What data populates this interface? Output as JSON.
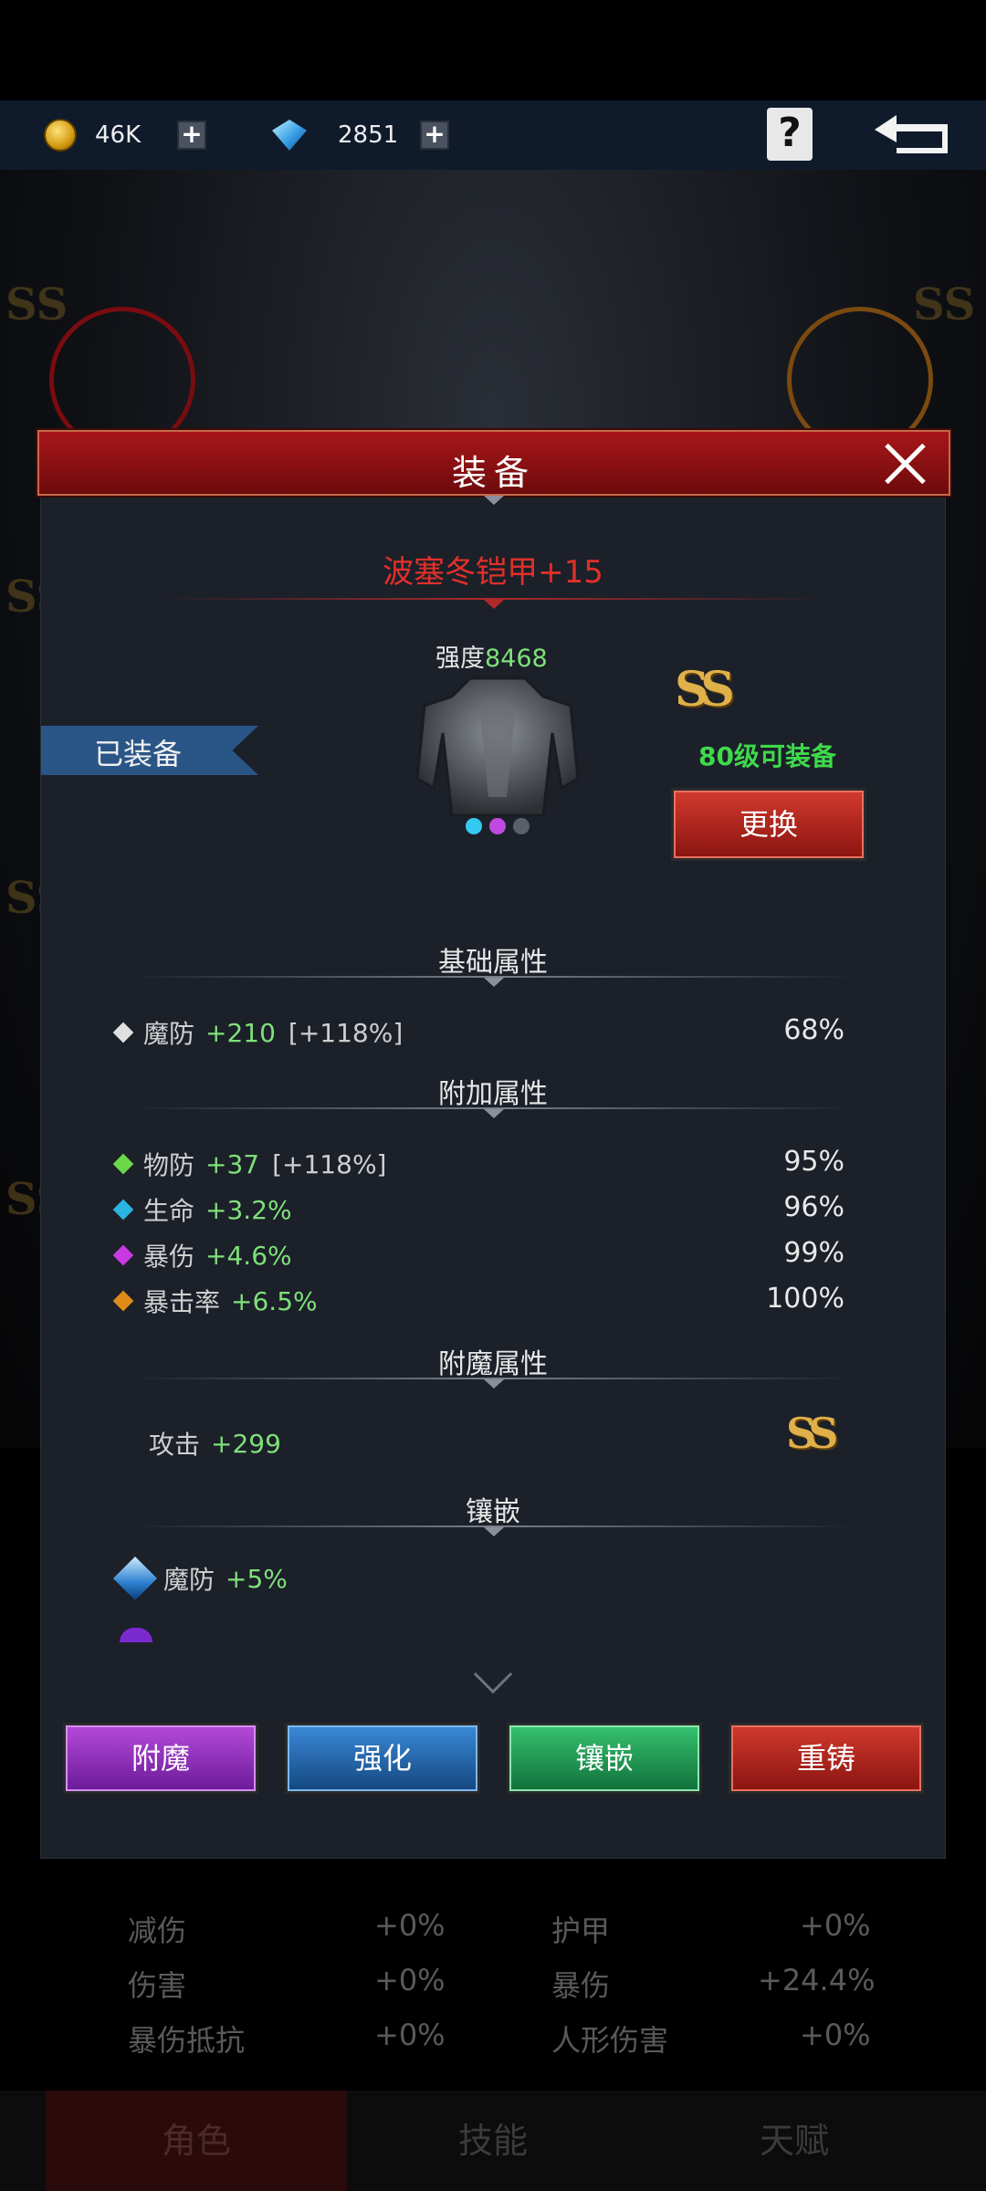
{
  "topbar": {
    "gold": {
      "icon": "gold-coin-icon",
      "value": "46K"
    },
    "diamond": {
      "icon": "diamond-icon",
      "value": "2851"
    },
    "help_icon": "help-book-icon",
    "back_icon": "back-arrow-icon"
  },
  "modal": {
    "title": "装备",
    "item_name": "波塞冬铠甲+15",
    "power_label": "强度",
    "power_value": "8468",
    "equipped_label": "已装备",
    "grade": "SS",
    "level_requirement": "80级可装备",
    "swap_button": "更换",
    "sections": {
      "base": "基础属性",
      "extra": "附加属性",
      "enchant": "附魔属性",
      "inlay": "镶嵌"
    },
    "base_attrs": [
      {
        "name": "魔防",
        "value": "+210",
        "bonus": "[+118%]",
        "quality": "68%",
        "color": "#e0e0e0"
      }
    ],
    "extra_attrs": [
      {
        "name": "物防",
        "value": "+37",
        "bonus": "[+118%]",
        "quality": "95%",
        "color": "#6bd84a"
      },
      {
        "name": "生命",
        "value": "+3.2%",
        "bonus": "",
        "quality": "96%",
        "color": "#2ab4e0"
      },
      {
        "name": "暴伤",
        "value": "+4.6%",
        "bonus": "",
        "quality": "99%",
        "color": "#c83ae0"
      },
      {
        "name": "暴击率",
        "value": "+6.5%",
        "bonus": "",
        "quality": "100%",
        "color": "#e08a1a"
      }
    ],
    "enchant_attr": {
      "name": "攻击",
      "value": "+299",
      "grade": "SS"
    },
    "inlay_attrs": [
      {
        "name": "魔防",
        "value": "+5%"
      }
    ],
    "buttons": {
      "enchant": "附魔",
      "upgrade": "强化",
      "inlay": "镶嵌",
      "recast": "重铸"
    }
  },
  "background_stats": [
    {
      "name": "减伤",
      "value": "+0%"
    },
    {
      "name": "护甲",
      "value": "+0%"
    },
    {
      "name": "伤害",
      "value": "+0%"
    },
    {
      "name": "暴伤",
      "value": "+24.4%"
    },
    {
      "name": "暴伤抵抗",
      "value": "+0%"
    },
    {
      "name": "人形伤害",
      "value": "+0%"
    }
  ],
  "bottom_tabs": [
    "角色",
    "技能",
    "天赋"
  ]
}
